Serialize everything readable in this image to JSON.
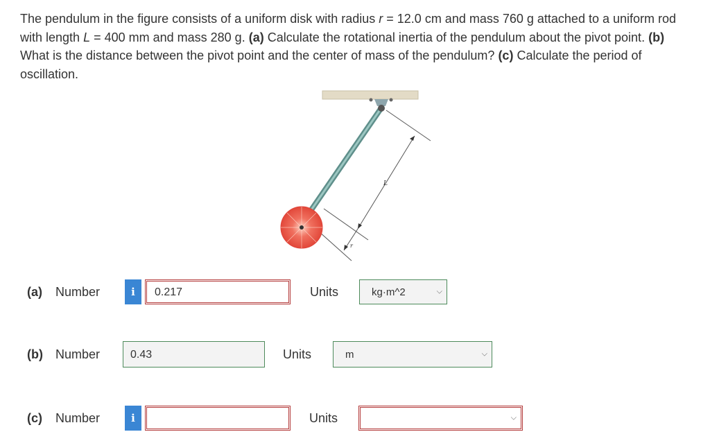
{
  "problem": {
    "text_1": "The pendulum in the figure consists of a uniform disk with radius ",
    "var_r": "r",
    "text_2": " = 12.0 cm and mass 760 g attached to a uniform rod with length ",
    "var_L": "L",
    "text_3": " = 400 mm and mass 280 g. ",
    "part_a_tag": "(a)",
    "part_a_text": " Calculate the rotational inertia of the pendulum about the pivot point. ",
    "part_b_tag": "(b)",
    "part_b_text": " What is the distance between the pivot point and the center of mass of the pendulum? ",
    "part_c_tag": "(c)",
    "part_c_text": " Calculate the period of oscillation."
  },
  "figure": {
    "label_L": "L",
    "label_r": "r",
    "colors": {
      "ceiling": "#e3dbc6",
      "rod": "#78a7a3",
      "disk": "#e7493d"
    }
  },
  "answers": [
    {
      "tag": "(a)",
      "label": "Number",
      "info_icon": "i",
      "value": "0.217",
      "units_label": "Units",
      "unit": "kg·m^2"
    },
    {
      "tag": "(b)",
      "label": "Number",
      "value": "0.43",
      "units_label": "Units",
      "unit": "m"
    },
    {
      "tag": "(c)",
      "label": "Number",
      "info_icon": "i",
      "value": "",
      "units_label": "Units",
      "unit": ""
    }
  ],
  "colors": {
    "info": "#3a86d4",
    "incorrect_border": "#b33a3a",
    "correct_border": "#4c8a5a"
  }
}
